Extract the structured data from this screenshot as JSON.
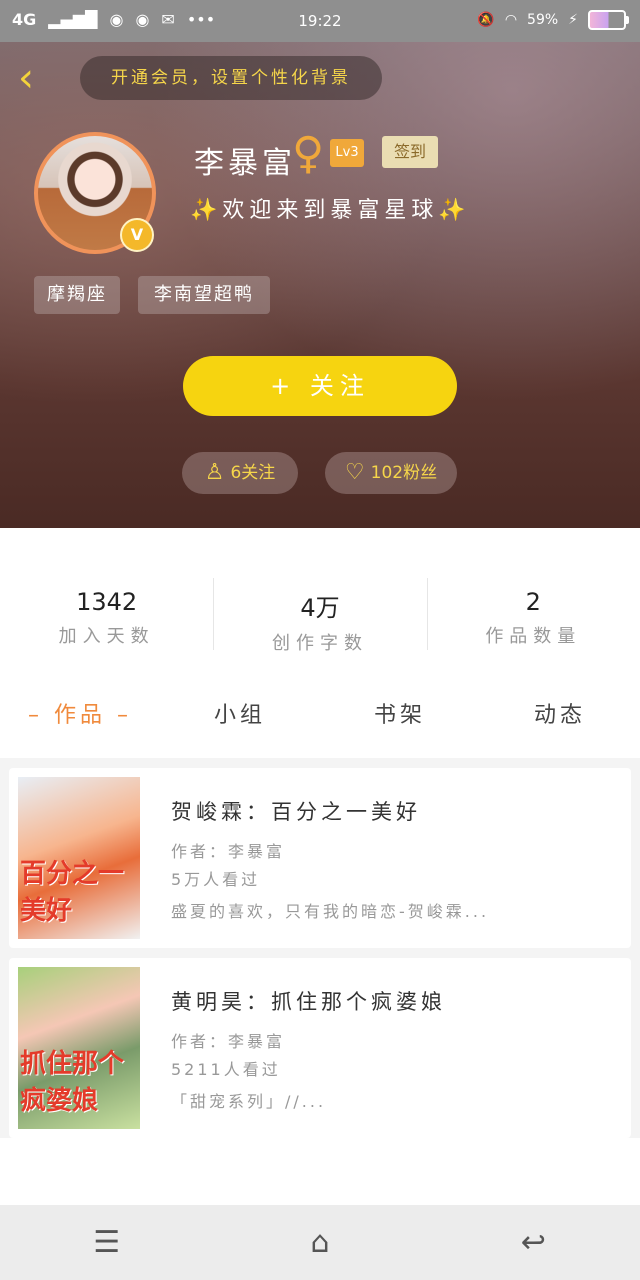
{
  "status_bar": {
    "network": "4G",
    "time": "19:22",
    "battery": "59%",
    "icons": [
      "signal-icon",
      "qq-icon",
      "qq-icon",
      "mail-icon",
      "more-icon",
      "mute-icon",
      "wifi-icon",
      "charging-icon",
      "battery-icon"
    ]
  },
  "header": {
    "vip_promo": "开通会员，设置个性化背景",
    "username": "李暴富",
    "gender_symbol": "♀",
    "level": "Lv3",
    "signin_label": "签到",
    "welcome": "欢迎来到暴富星球",
    "vip_badge": "V",
    "tags": [
      "摩羯座",
      "李南望超鸭"
    ],
    "follow_label": "+ 关注",
    "following": "6关注",
    "fans": "102粉丝"
  },
  "stats": [
    {
      "value": "1342",
      "label": "加入天数"
    },
    {
      "value": "4万",
      "label": "创作字数"
    },
    {
      "value": "2",
      "label": "作品数量"
    }
  ],
  "tabs": [
    {
      "label": "作品",
      "active": true
    },
    {
      "label": "小组",
      "active": false
    },
    {
      "label": "书架",
      "active": false
    },
    {
      "label": "动态",
      "active": false
    }
  ],
  "works": [
    {
      "cover_text": "百分之一美好",
      "title": "贺峻霖：百分之一美好",
      "author": "作者：李暴富",
      "views": "5万人看过",
      "desc": "盛夏的喜欢，只有我的暗恋-贺峻霖..."
    },
    {
      "cover_text": "抓住那个疯婆娘",
      "title": "黄明昊：抓住那个疯婆娘",
      "author": "作者：李暴富",
      "views": "5211人看过",
      "desc": "「甜宠系列」//..."
    }
  ],
  "colors": {
    "accent": "#f6d410",
    "tab_active": "#f08a3c",
    "vip_text": "#f6d64a"
  }
}
